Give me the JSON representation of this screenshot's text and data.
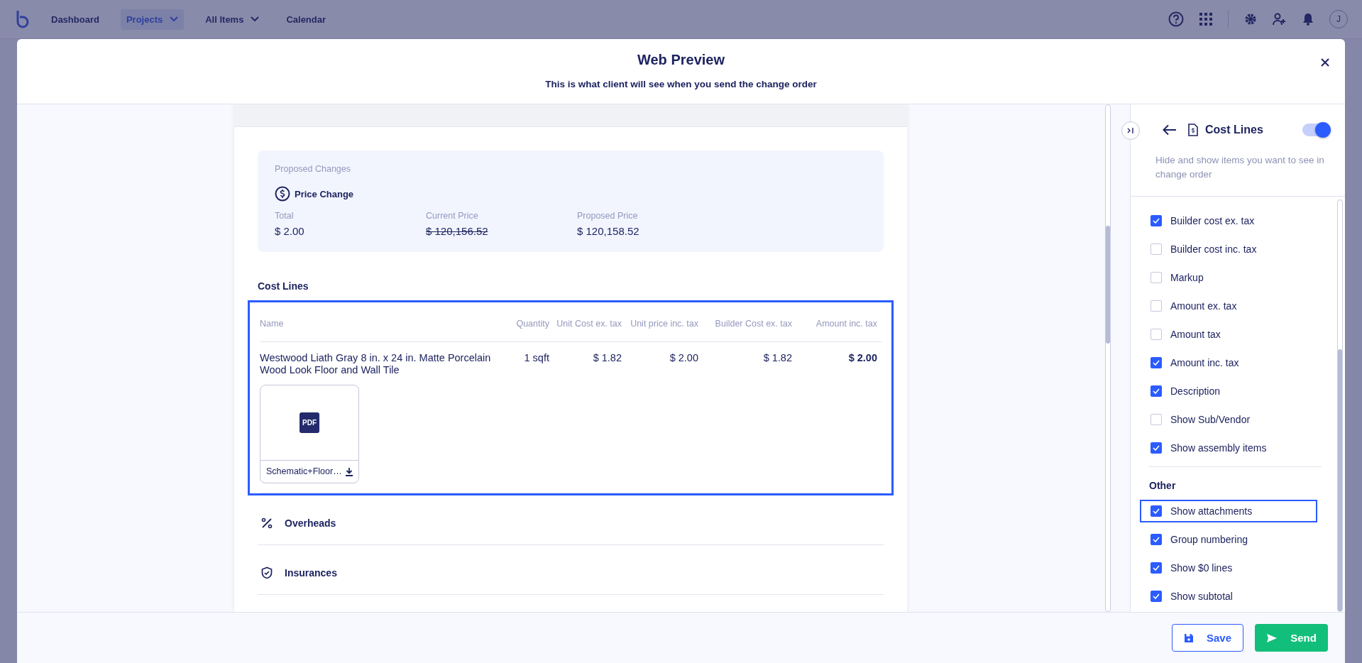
{
  "top_nav": {
    "items": [
      {
        "label": "Dashboard",
        "selected": false,
        "dropdown": false
      },
      {
        "label": "Projects",
        "selected": true,
        "dropdown": true
      },
      {
        "label": "All Items",
        "selected": false,
        "dropdown": true
      },
      {
        "label": "Calendar",
        "selected": false,
        "dropdown": false
      }
    ],
    "avatar": "J"
  },
  "modal": {
    "title": "Web Preview",
    "subtitle": "This is what client will see when you send the change order"
  },
  "preview": {
    "proposed_changes": {
      "heading": "Proposed Changes",
      "change_type": "Price Change",
      "fields": [
        {
          "label": "Total",
          "value": "$ 2.00",
          "struck": false
        },
        {
          "label": "Current Price",
          "value": "$ 120,156.52",
          "struck": true
        },
        {
          "label": "Proposed Price",
          "value": "$ 120,158.52",
          "struck": false
        }
      ]
    },
    "cost_lines": {
      "heading": "Cost Lines",
      "highlighted": true,
      "columns": [
        "Name",
        "Quantity",
        "Unit Cost ex. tax",
        "Unit price inc. tax",
        "Builder Cost ex. tax",
        "Amount inc. tax"
      ],
      "rows": [
        {
          "cells": [
            "Westwood Liath Gray 8 in. x 24 in. Matte Porcelain Wood Look Floor and Wall Tile",
            "1 sqft",
            "$ 1.82",
            "$ 2.00",
            "$ 1.82",
            "$ 2.00"
          ],
          "attachments": [
            {
              "badge": "PDF",
              "file_name": "Schematic+Floor…"
            }
          ]
        }
      ]
    },
    "sections": [
      {
        "kind": "percent",
        "label": "Overheads"
      },
      {
        "kind": "shield",
        "label": "Insurances"
      }
    ]
  },
  "settings_panel": {
    "title": "Cost Lines",
    "enabled": true,
    "description": "Hide and show items you want to see in change order",
    "groups": [
      {
        "options": [
          {
            "label": "Builder cost ex. tax",
            "checked": true,
            "highlighted": false
          },
          {
            "label": "Builder cost inc. tax",
            "checked": false,
            "highlighted": false
          },
          {
            "label": "Markup",
            "checked": false,
            "highlighted": false
          },
          {
            "label": "Amount ex. tax",
            "checked": false,
            "highlighted": false
          },
          {
            "label": "Amount tax",
            "checked": false,
            "highlighted": false
          },
          {
            "label": "Amount inc. tax",
            "checked": true,
            "highlighted": false
          },
          {
            "label": "Description",
            "checked": true,
            "highlighted": false
          },
          {
            "label": "Show Sub/Vendor",
            "checked": false,
            "highlighted": false
          },
          {
            "label": "Show assembly items",
            "checked": true,
            "highlighted": false
          }
        ]
      },
      {
        "heading": "Other",
        "options": [
          {
            "label": "Show attachments",
            "checked": true,
            "highlighted": true
          },
          {
            "label": "Group numbering",
            "checked": true,
            "highlighted": false
          },
          {
            "label": "Show $0 lines",
            "checked": true,
            "highlighted": false
          },
          {
            "label": "Show subtotal",
            "checked": true,
            "highlighted": false
          }
        ]
      }
    ]
  },
  "buttons": [
    {
      "kind": "outline",
      "label": "Save"
    },
    {
      "kind": "primary",
      "label": "Send"
    }
  ]
}
